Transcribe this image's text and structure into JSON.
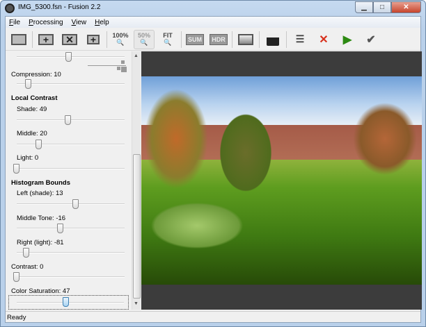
{
  "window": {
    "title": "IMG_5300.fsn - Fusion 2.2"
  },
  "menu": [
    {
      "label": "File",
      "key": "F",
      "rest": "ile"
    },
    {
      "label": "Processing",
      "key": "P",
      "rest": "rocessing"
    },
    {
      "label": "View",
      "key": "V",
      "rest": "iew"
    },
    {
      "label": "Help",
      "key": "H",
      "rest": "elp"
    }
  ],
  "toolbar": {
    "zoom100": "100%",
    "zoom50": "50%",
    "fit": "FIT",
    "sum": "SUM",
    "hdr": "HDR"
  },
  "panel": {
    "compression": {
      "label": "Compression: 10",
      "value": 10,
      "fraction": 0.11
    },
    "top_slider": {
      "fraction": 0.5
    },
    "local_contrast": "Local Contrast",
    "shade": {
      "label": "Shade: 49",
      "value": 49,
      "fraction": 0.49
    },
    "middle": {
      "label": "Middle: 20",
      "value": 20,
      "fraction": 0.21
    },
    "light": {
      "label": "Light: 0",
      "value": 0,
      "fraction": 0
    },
    "histogram_bounds": "Histogram Bounds",
    "left_shade": {
      "label": "Left (shade): 13",
      "value": 13,
      "fraction": 0.565
    },
    "middle_tone": {
      "label": "Middle Tone: -16",
      "value": -16,
      "fraction": 0.42
    },
    "right_light": {
      "label": "Right (light): -81",
      "value": -81,
      "fraction": 0.095
    },
    "contrast": {
      "label": "Contrast: 0",
      "value": 0,
      "fraction": 0
    },
    "color_saturation": {
      "label": "Color Saturation: 47",
      "value": 47,
      "fraction": 0.47
    }
  },
  "status": "Ready"
}
